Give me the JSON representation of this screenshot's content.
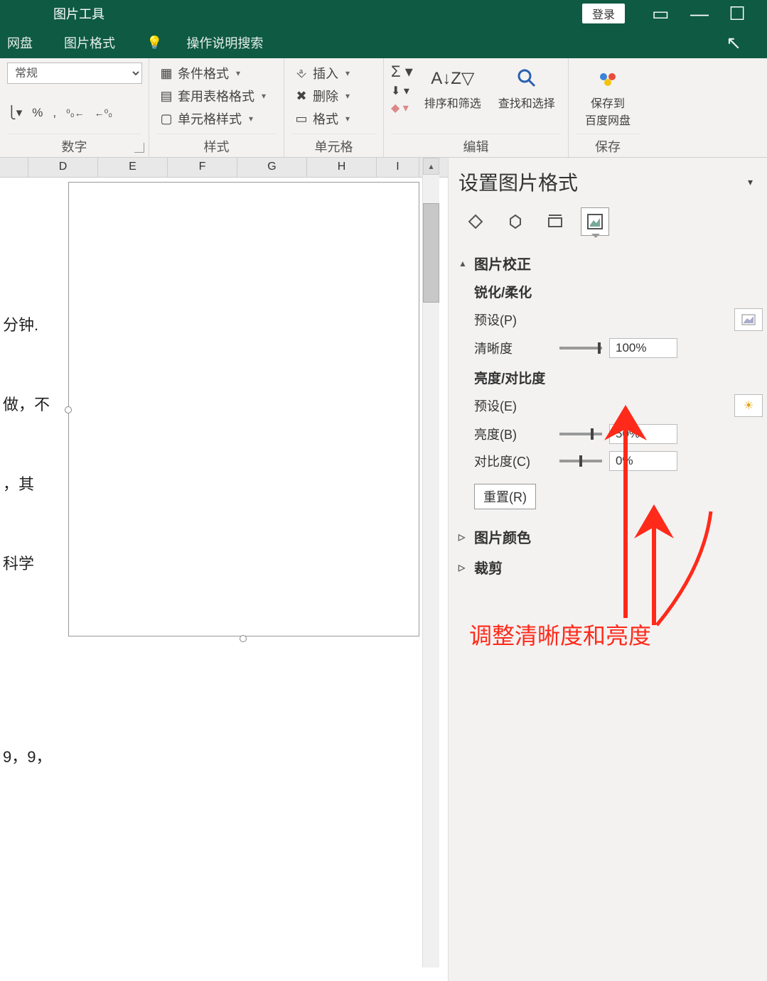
{
  "titlebar": {
    "tool_context": "图片工具",
    "login": "登录"
  },
  "tabs": {
    "netdisk": "网盘",
    "picture_format": "图片格式",
    "helptip": "操作说明搜索"
  },
  "ribbon": {
    "number": {
      "label": "数字",
      "format_sel": "常规",
      "accounting": "",
      "percent": "%",
      "comma": ",",
      "inc": ".00←",
      "dec": "←.00"
    },
    "styles": {
      "label": "样式",
      "cond": "条件格式",
      "table": "套用表格格式",
      "cell": "单元格样式"
    },
    "cells": {
      "label": "单元格",
      "insert": "插入",
      "delete": "删除",
      "format": "格式"
    },
    "editing": {
      "label": "编辑",
      "sort": "排序和筛选",
      "find": "查找和选择"
    },
    "save": {
      "label": "保存",
      "baidu": "保存到\n百度网盘"
    }
  },
  "cols": [
    "D",
    "E",
    "F",
    "G",
    "H",
    "I"
  ],
  "sidecells": [
    "分钟.",
    "做，不",
    "，其",
    "科学",
    "9，9，"
  ],
  "pane": {
    "title": "设置图片格式",
    "section_correct": "图片校正",
    "sharpen_soften": "锐化/柔化",
    "preset_p": "预设(P)",
    "sharpness": "清晰度",
    "sharpness_val": "100%",
    "bright_contrast": "亮度/对比度",
    "preset_e": "预设(E)",
    "brightness": "亮度(B)",
    "brightness_val": "50%",
    "contrast": "对比度(C)",
    "contrast_val": "0%",
    "reset": "重置(R)",
    "section_color": "图片颜色",
    "section_crop": "裁剪"
  },
  "annotation": "调整清晰度和亮度"
}
